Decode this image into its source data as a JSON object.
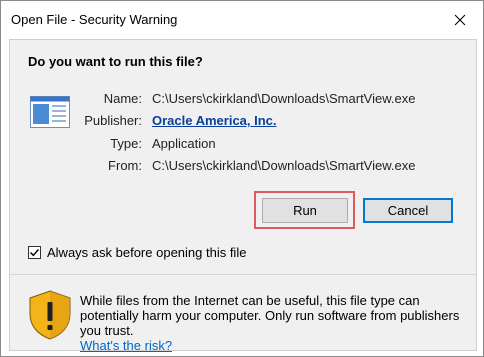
{
  "window": {
    "title": "Open File - Security Warning"
  },
  "dialog": {
    "question": "Do you want to run this file?",
    "fields": [
      {
        "label": "Name:",
        "value": "C:\\Users\\ckirkland\\Downloads\\SmartView.exe"
      },
      {
        "label": "Publisher:",
        "value": "Oracle America, Inc."
      },
      {
        "label": "Type:",
        "value": "Application"
      },
      {
        "label": "From:",
        "value": "C:\\Users\\ckirkland\\Downloads\\SmartView.exe"
      }
    ],
    "run_label": "Run",
    "cancel_label": "Cancel",
    "checkbox_label": "Always ask before opening this file",
    "checkbox_checked": true,
    "warning_text": "While files from the Internet can be useful, this file type can potentially harm your computer. Only run software from publishers you trust.",
    "risk_link": "What's the risk?"
  },
  "icons": {
    "close": "close-icon",
    "file": "application-file-icon",
    "shield": "security-shield-icon",
    "checkmark": "checkmark-icon"
  },
  "colors": {
    "link_publisher": "#0a3e9c",
    "link_risk": "#0066cc",
    "focus_border": "#0078d7",
    "highlight_border": "#e05a63",
    "shield_yellow": "#f2b418"
  }
}
